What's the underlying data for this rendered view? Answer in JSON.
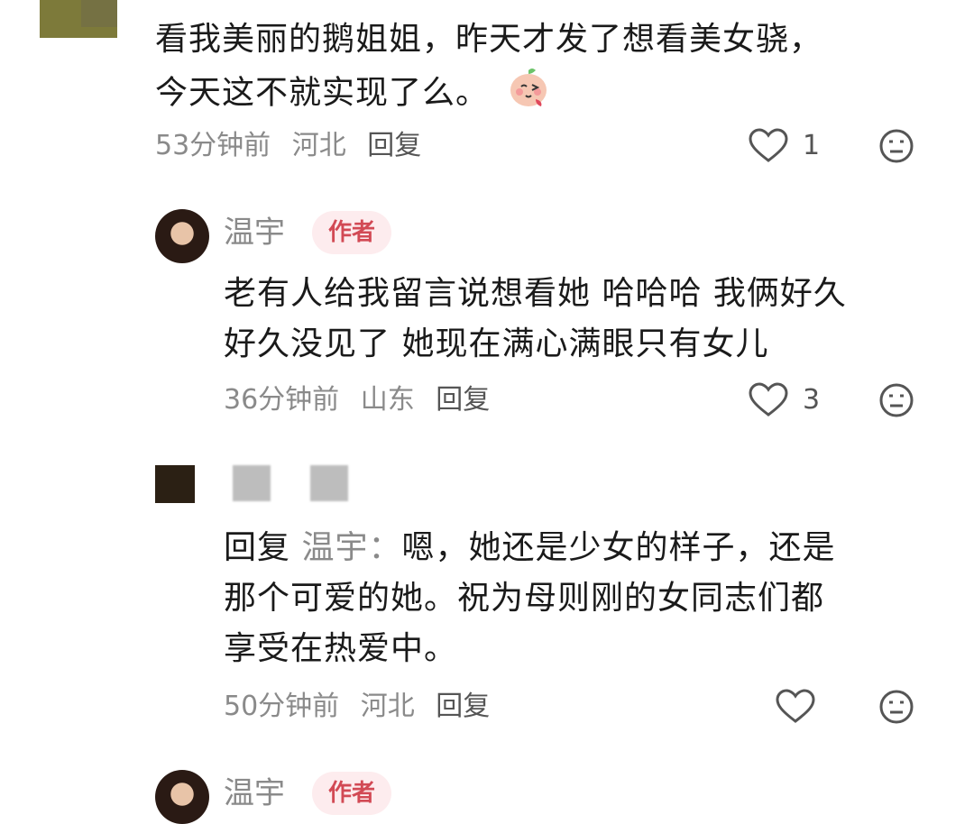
{
  "comments": [
    {
      "text_line1": "看我美丽的鹅姐姐，昨天才发了想看美女骁，",
      "text_line2": "今天这不就实现了么。",
      "emoji": "blush-face-emoji",
      "time": "53分钟前",
      "location": "河北",
      "reply_label": "回复",
      "likes": "1"
    }
  ],
  "author_reply": {
    "name": "温宇",
    "tag": "作者",
    "text_line1": "老有人给我留言说想看她 哈哈哈 我俩好久",
    "text_line2": "好久没见了 她现在满心满眼只有女儿",
    "time": "36分钟前",
    "location": "山东",
    "reply_label": "回复",
    "likes": "3"
  },
  "user_reply": {
    "prefix": "回复",
    "target": "温宇：",
    "text_line1": "嗯，她还是少女的样子，还是",
    "text_line2": "那个可爱的她。祝为母则刚的女同志们都",
    "text_line3": "享受在热爱中。",
    "time": "50分钟前",
    "location": "河北",
    "reply_label": "回复"
  },
  "partial_next": {
    "name": "温宇",
    "tag": "作者"
  },
  "icons": {
    "like": "heart-outline-icon",
    "dislike": "neutral-face-icon"
  },
  "colors": {
    "meta_gray": "#8a8a8a",
    "author_tag_text": "#d24a55",
    "author_tag_bg": "#fdecee"
  }
}
